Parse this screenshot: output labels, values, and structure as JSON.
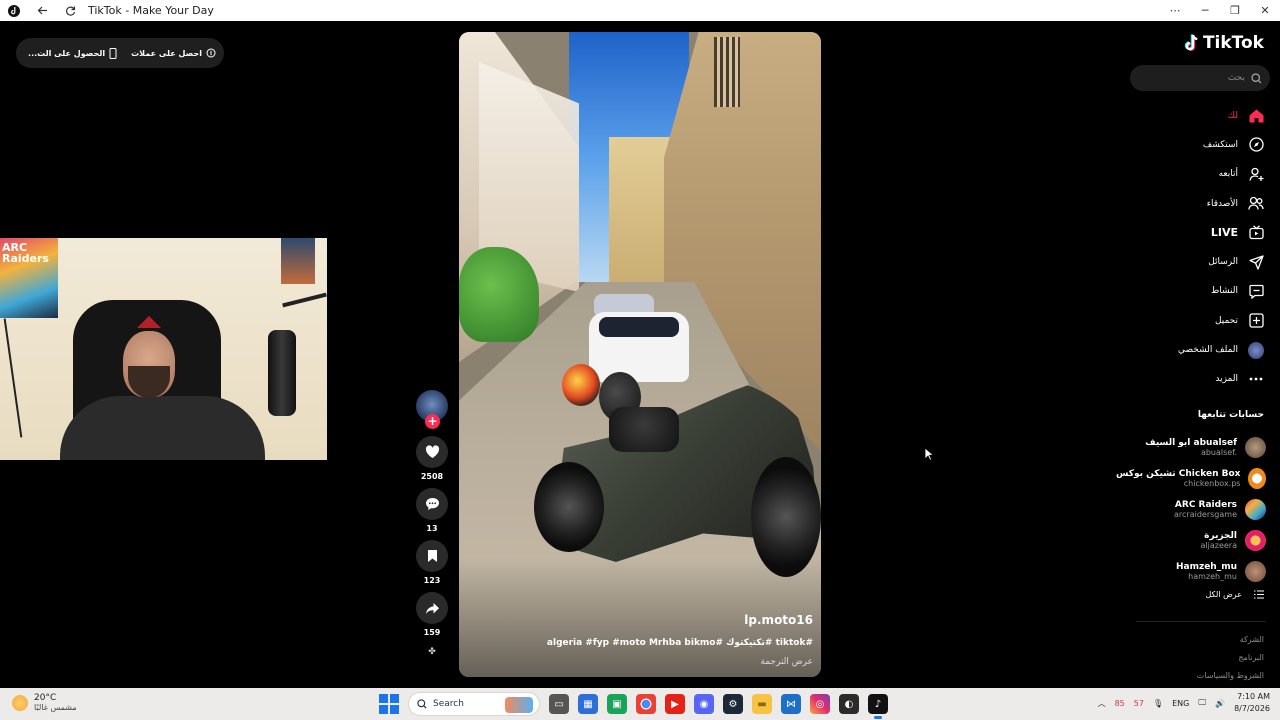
{
  "window": {
    "title": "TikTok - Make Your Day"
  },
  "top_overlay": {
    "get_coins": "احصل على عملات",
    "get_app": "الحصول على الت..."
  },
  "video": {
    "author": "lp.moto16",
    "caption": "#tiktok #تكتيكتوك #algeria #fyp #moto Mrhba bikmo",
    "translate": "عرض الترجمة"
  },
  "actions": {
    "likes": "2508",
    "comments": "13",
    "saves": "123",
    "shares": "159"
  },
  "sidebar": {
    "logo": "TikTok",
    "search_placeholder": "بحث",
    "nav": [
      {
        "label": "لك",
        "icon": "home-icon"
      },
      {
        "label": "استكشف",
        "icon": "explore-icon"
      },
      {
        "label": "أتابعه",
        "icon": "following-icon"
      },
      {
        "label": "الأصدقاء",
        "icon": "friends-icon"
      },
      {
        "label": "LIVE",
        "icon": "live-icon"
      },
      {
        "label": "الرسائل",
        "icon": "messages-icon"
      },
      {
        "label": "النشاط",
        "icon": "activity-icon"
      },
      {
        "label": "تحميل",
        "icon": "upload-icon"
      },
      {
        "label": "الملف الشخصي",
        "icon": "profile-avatar"
      },
      {
        "label": "المزيد",
        "icon": "more-icon"
      }
    ],
    "following_title": "حسابات تتابعها",
    "following": [
      {
        "name": "ابو السيف abualsef",
        "handle": "abualsef.",
        "color": "#8a7a6a"
      },
      {
        "name": "تشيكن بوكس Chicken Box",
        "handle": "chickenbox.ps",
        "color": "#f08a1c"
      },
      {
        "name": "ARC Raiders",
        "handle": "arcraidersgame",
        "color": "#2d2d2d"
      },
      {
        "name": "الجزيرة",
        "handle": "aljazeera",
        "color": "#e0206a"
      },
      {
        "name": "Hamzeh_mu",
        "handle": "hamzeh_mu",
        "color": "#7a5a4a"
      }
    ],
    "see_all": "عرض الكل",
    "footer_links": [
      "الشركة",
      "البرنامج",
      "الشروط والسياسات"
    ]
  },
  "taskbar": {
    "weather_temp": "20°C",
    "weather_desc": "مشمس غالبًا",
    "search_label": "Search",
    "lang": "ENG",
    "time": "7:10 AM",
    "date": "8/7/2026",
    "tray_nums": [
      "85",
      "57"
    ]
  },
  "colors": {
    "tiktok_red": "#fe2c55",
    "accent_cyan": "#25f4ee"
  }
}
